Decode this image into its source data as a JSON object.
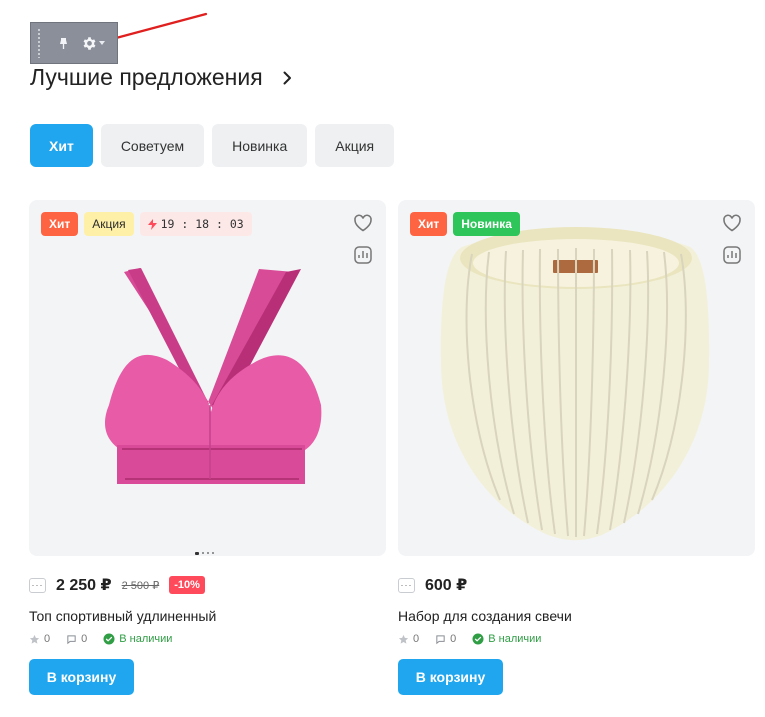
{
  "section": {
    "title": "Лучшие предложения"
  },
  "tabs": [
    {
      "label": "Хит",
      "active": true
    },
    {
      "label": "Советуем",
      "active": false
    },
    {
      "label": "Новинка",
      "active": false
    },
    {
      "label": "Акция",
      "active": false
    }
  ],
  "admin_toolbar": {
    "icons": [
      "drag-handle-icon",
      "pin-icon",
      "gear-icon",
      "chevron-down-icon"
    ]
  },
  "products": [
    {
      "badges": {
        "hit": "Хит",
        "sale": "Акция",
        "timer": "19 : 18 : 03"
      },
      "price": "2 250 ₽",
      "old_price": "2 500 ₽",
      "discount": "-10%",
      "name": "Топ спортивный удлиненный",
      "rating": "0",
      "reviews": "0",
      "stock": "В наличии",
      "cart_label": "В корзину",
      "image": "pink-sports-bra"
    },
    {
      "badges": {
        "hit": "Хит",
        "new": "Новинка"
      },
      "price": "600 ₽",
      "name": "Набор для создания свечи",
      "rating": "0",
      "reviews": "0",
      "stock": "В наличии",
      "cart_label": "В корзину",
      "image": "white-ribbed-candle"
    }
  ],
  "colors": {
    "accent": "#1fa6ee",
    "hit_badge": "#ff6442",
    "new_badge": "#2ec55a",
    "sale_badge": "#fff0a8",
    "discount_badge": "#ff4a5b",
    "stock": "#2f9e44"
  }
}
